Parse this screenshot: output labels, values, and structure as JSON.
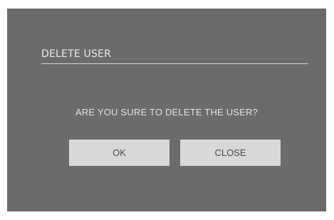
{
  "dialog": {
    "title": "DELETE USER",
    "message": "ARE YOU SURE TO DELETE THE USER?",
    "ok_label": "OK",
    "close_label": "CLOSE"
  },
  "colors": {
    "dialog_background": "#6b6b6b",
    "button_background": "#d8d8d8",
    "text_light": "#ececec"
  }
}
